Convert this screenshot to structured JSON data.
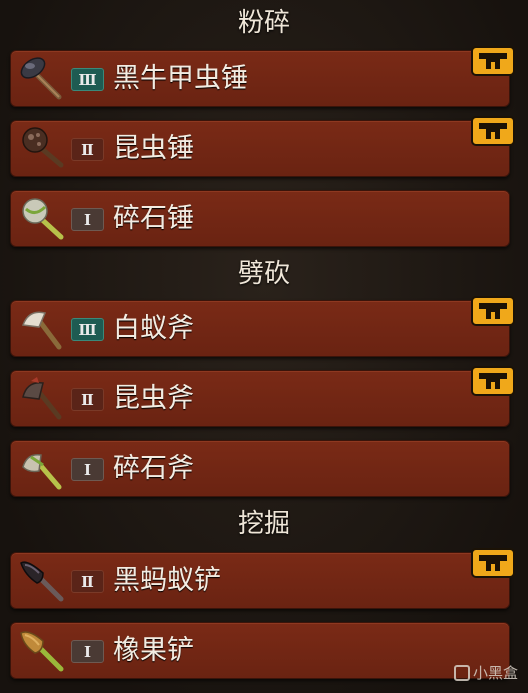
{
  "sections": [
    {
      "title": "粉碎"
    },
    {
      "title": "劈砍"
    },
    {
      "title": "挖掘"
    }
  ],
  "items": [
    {
      "tier": "Ⅲ",
      "tier_level": 3,
      "name": "黑牛甲虫锤",
      "has_badge": true,
      "icon": "black-ox-beetle-hammer-icon"
    },
    {
      "tier": "Ⅱ",
      "tier_level": 2,
      "name": "昆虫锤",
      "has_badge": true,
      "icon": "insect-hammer-icon"
    },
    {
      "tier": "Ⅰ",
      "tier_level": 1,
      "name": "碎石锤",
      "has_badge": false,
      "icon": "pebble-hammer-icon"
    },
    {
      "tier": "Ⅲ",
      "tier_level": 3,
      "name": "白蚁斧",
      "has_badge": true,
      "icon": "termite-axe-icon"
    },
    {
      "tier": "Ⅱ",
      "tier_level": 2,
      "name": "昆虫斧",
      "has_badge": true,
      "icon": "insect-axe-icon"
    },
    {
      "tier": "Ⅰ",
      "tier_level": 1,
      "name": "碎石斧",
      "has_badge": false,
      "icon": "pebble-axe-icon"
    },
    {
      "tier": "Ⅱ",
      "tier_level": 2,
      "name": "黑蚂蚁铲",
      "has_badge": true,
      "icon": "black-ant-shovel-icon"
    },
    {
      "tier": "Ⅰ",
      "tier_level": 1,
      "name": "橡果铲",
      "has_badge": false,
      "icon": "acorn-shovel-icon"
    }
  ],
  "watermark": {
    "text": "小黑盒"
  },
  "colors": {
    "row": "#6e2514",
    "badge": "#f0a81a",
    "tier3": "#1e5b52"
  }
}
